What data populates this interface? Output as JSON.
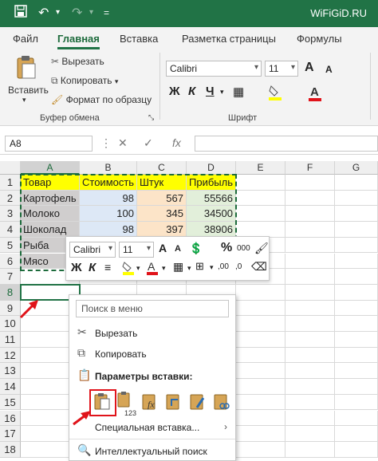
{
  "titlebar": {
    "brand": "WiFiGiD.RU"
  },
  "tabs": [
    "Файл",
    "Главная",
    "Вставка",
    "Разметка страницы",
    "Формулы"
  ],
  "ribbon": {
    "paste_label": "Вставить",
    "cut_label": "Вырезать",
    "copy_label": "Копировать",
    "format_painter_label": "Формат по образцу",
    "clipboard_group": "Буфер обмена",
    "font_group": "Шрифт",
    "font_name": "Calibri",
    "font_size": "11",
    "bold": "Ж",
    "italic": "К",
    "underline": "Ч",
    "grow": "A",
    "shrink": "A"
  },
  "formula_bar": {
    "cell_ref": "A8",
    "fx": "fx"
  },
  "columns": [
    "A",
    "B",
    "C",
    "D",
    "E",
    "F",
    "G"
  ],
  "rows": [
    "1",
    "2",
    "3",
    "4",
    "5",
    "6",
    "7",
    "8",
    "9",
    "10",
    "11",
    "12",
    "13",
    "14",
    "15",
    "16",
    "17",
    "18"
  ],
  "table": {
    "headers": [
      "Товар",
      "Стоимость",
      "Штук",
      "Прибыль"
    ],
    "rows": [
      [
        "Картофель",
        "98",
        "567",
        "55566"
      ],
      [
        "Молоко",
        "100",
        "345",
        "34500"
      ],
      [
        "Шоколад",
        "98",
        "397",
        "38906"
      ],
      [
        "Рыба",
        "",
        "",
        ""
      ],
      [
        "Мясо",
        "",
        "",
        ""
      ]
    ]
  },
  "mini_toolbar": {
    "font_name": "Calibri",
    "font_size": "11",
    "grow": "A",
    "shrink": "A",
    "percent": "%",
    "thousands": "000",
    "bold": "Ж",
    "italic": "К",
    "font_color": "A"
  },
  "context_menu": {
    "search_placeholder": "Поиск в меню",
    "cut": "Вырезать",
    "copy": "Копировать",
    "paste_options": "Параметры вставки:",
    "paste_special": "Специальная вставка...",
    "smart_lookup": "Интеллектуальный поиск",
    "paste_values_sub": "123"
  },
  "colors": {
    "excel_green": "#217346",
    "highlight_yellow": "#ffff00",
    "annotation_red": "#e0131a"
  }
}
